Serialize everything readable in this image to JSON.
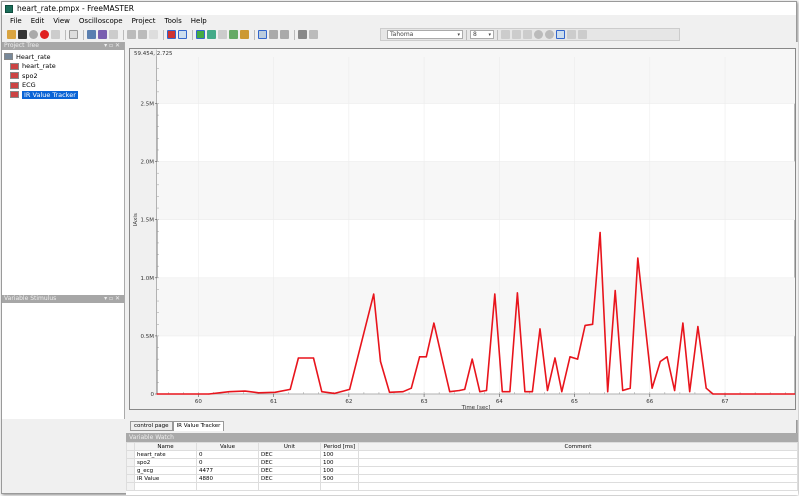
{
  "window": {
    "title": "heart_rate.pmpx - FreeMASTER"
  },
  "menu": [
    "File",
    "Edit",
    "View",
    "Oscilloscope",
    "Project",
    "Tools",
    "Help"
  ],
  "format_toolbar": {
    "font": "Tahoma",
    "size": "8"
  },
  "project_tree": {
    "title": "Project Tree",
    "root": "Heart_rate",
    "items": [
      "heart_rate",
      "spo2",
      "ECG",
      "IR Value Tracker"
    ],
    "selected": "IR Value Tracker"
  },
  "variable_stimulus": {
    "title": "Variable Stimulus"
  },
  "colors": {
    "series": "#e8141c",
    "selection": "#0a64d6"
  },
  "chart_data": {
    "type": "line",
    "readout": "59.454, 2.725",
    "title": "",
    "xlabel": "Time [sec]",
    "ylabel": "IAxis",
    "xlim": [
      59.45,
      67.93
    ],
    "ylim": [
      0,
      2.9
    ],
    "xticks": [
      "60",
      "61",
      "62",
      "63",
      "64",
      "65",
      "66",
      "67"
    ],
    "yticks": [
      {
        "v": 0,
        "label": "0"
      },
      {
        "v": 0.5,
        "label": "0.5M"
      },
      {
        "v": 1.0,
        "label": "1.0M"
      },
      {
        "v": 1.5,
        "label": "1.5M"
      },
      {
        "v": 2.0,
        "label": "2.0M"
      },
      {
        "v": 2.5,
        "label": "2.5M"
      }
    ],
    "grid": true,
    "series": [
      {
        "name": "IR Value",
        "x": [
          59.45,
          60.14,
          60.41,
          60.62,
          60.8,
          61.02,
          61.22,
          61.33,
          61.53,
          61.64,
          61.81,
          62.01,
          62.33,
          62.42,
          62.54,
          62.72,
          62.83,
          62.94,
          63.03,
          63.13,
          63.25,
          63.34,
          63.47,
          63.54,
          63.64,
          63.74,
          63.83,
          63.94,
          64.04,
          64.14,
          64.24,
          64.34,
          64.44,
          64.54,
          64.64,
          64.74,
          64.83,
          64.94,
          65.04,
          65.14,
          65.24,
          65.34,
          65.44,
          65.54,
          65.64,
          65.74,
          65.84,
          66.03,
          66.14,
          66.23,
          66.33,
          66.44,
          66.53,
          66.64,
          66.75,
          66.84,
          67.93
        ],
        "y": [
          0,
          0,
          0.02,
          0.025,
          0.01,
          0.015,
          0.04,
          0.31,
          0.31,
          0.02,
          0.005,
          0.04,
          0.86,
          0.28,
          0.015,
          0.02,
          0.05,
          0.32,
          0.32,
          0.61,
          0.27,
          0.02,
          0.03,
          0.04,
          0.3,
          0.02,
          0.03,
          0.86,
          0.02,
          0.02,
          0.87,
          0.02,
          0.02,
          0.56,
          0.03,
          0.31,
          0.02,
          0.32,
          0.3,
          0.59,
          0.6,
          1.39,
          0.02,
          0.89,
          0.03,
          0.05,
          1.17,
          0.05,
          0.28,
          0.32,
          0.03,
          0.61,
          0.02,
          0.58,
          0.05,
          0,
          0
        ]
      }
    ]
  },
  "tabs": [
    "control page",
    "IR Value Tracker"
  ],
  "variable_watch": {
    "title": "Variable Watch",
    "columns": [
      "Name",
      "Value",
      "Unit",
      "Period [ms]",
      "Comment"
    ],
    "rows": [
      [
        "heart_rate",
        "0",
        "DEC",
        "100",
        ""
      ],
      [
        "spo2",
        "0",
        "DEC",
        "100",
        ""
      ],
      [
        "g_ecg",
        "4477",
        "DEC",
        "100",
        ""
      ],
      [
        "IR Value",
        "4880",
        "DEC",
        "500",
        ""
      ]
    ]
  }
}
